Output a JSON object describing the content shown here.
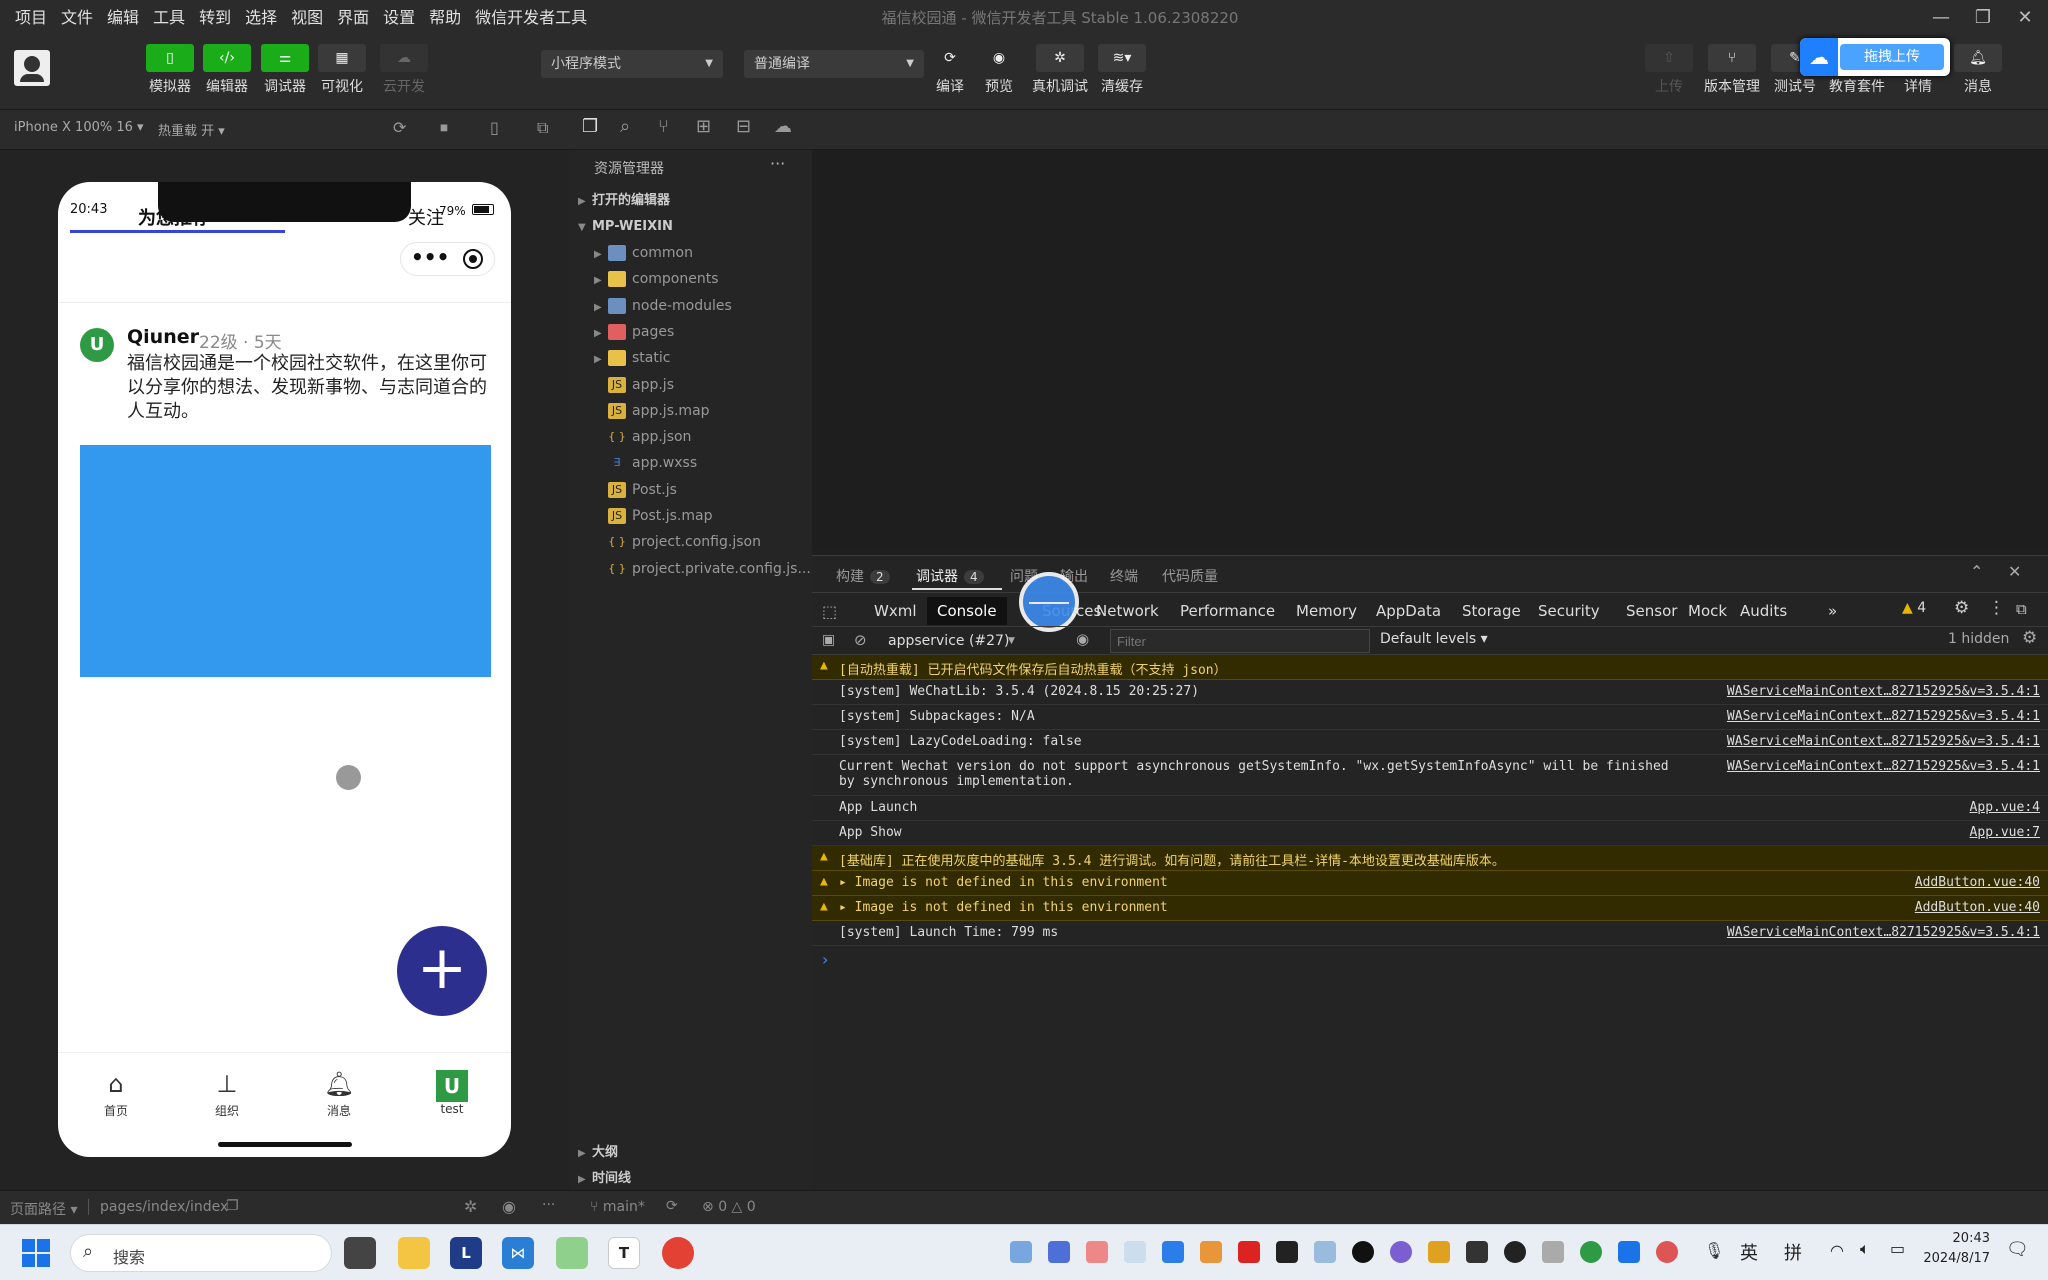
{
  "menubar": {
    "items": [
      "项目",
      "文件",
      "编辑",
      "工具",
      "转到",
      "选择",
      "视图",
      "界面",
      "设置",
      "帮助",
      "微信开发者工具"
    ],
    "title": "福信校园通 - 微信开发者工具 Stable 1.06.2308220"
  },
  "toolbar": {
    "simulator": "模拟器",
    "editor": "编辑器",
    "debugger": "调试器",
    "visual": "可视化",
    "cloud": "云开发",
    "mode": "小程序模式",
    "compile_mode": "普通编译",
    "compile": "编译",
    "preview": "预览",
    "real_debug": "真机调试",
    "clear_cache": "清缓存",
    "upload": "上传",
    "version": "版本管理",
    "test": "测试号",
    "edu": "教育套件",
    "details": "详情",
    "messages": "消息",
    "drag_upload": "拖拽上传"
  },
  "subbar": {
    "device": "iPhone X 100% 16",
    "hot_reload": "热重载 开"
  },
  "phone": {
    "time": "20:43",
    "tab_left": "为您推荐",
    "tab_right": "关注",
    "battery": "79%",
    "post": {
      "avatar": "U",
      "user": "Qiuner",
      "meta": "22级 · 5天",
      "text": "福信校园通是一个校园社交软件，在这里你可以分享你的想法、发现新事物、与志同道合的人互动。"
    },
    "image_color": "#3399ee",
    "fab": "+",
    "nav": [
      {
        "label": "首页",
        "icon": "home-icon"
      },
      {
        "label": "组织",
        "icon": "org-icon"
      },
      {
        "label": "消息",
        "icon": "bell-icon"
      },
      {
        "label": "test",
        "icon": "u-avatar-icon"
      }
    ]
  },
  "explorer": {
    "title": "资源管理器",
    "open_editors": "打开的编辑器",
    "root": "MP-WEIXIN",
    "items": [
      {
        "name": "common",
        "type": "folder",
        "color": "#6b8fbf"
      },
      {
        "name": "components",
        "type": "folder",
        "color": "#e8c14a"
      },
      {
        "name": "node-modules",
        "type": "folder",
        "color": "#6b8fbf"
      },
      {
        "name": "pages",
        "type": "folder",
        "color": "#e06060"
      },
      {
        "name": "static",
        "type": "folder",
        "color": "#e8c14a"
      },
      {
        "name": "app.js",
        "type": "js",
        "color": "#d9b23b"
      },
      {
        "name": "app.js.map",
        "type": "map",
        "color": "#d9b23b"
      },
      {
        "name": "app.json",
        "type": "json",
        "color": "#d9b23b"
      },
      {
        "name": "app.wxss",
        "type": "wxss",
        "color": "#4a7fd9"
      },
      {
        "name": "Post.js",
        "type": "js",
        "color": "#d9b23b"
      },
      {
        "name": "Post.js.map",
        "type": "map",
        "color": "#d9b23b"
      },
      {
        "name": "project.config.json",
        "type": "json",
        "color": "#d9b23b"
      },
      {
        "name": "project.private.config.js...",
        "type": "json",
        "color": "#d9b23b"
      }
    ],
    "outline": "大纲",
    "timeline": "时间线"
  },
  "devtools": {
    "tabs": [
      {
        "label": "构建",
        "badge": "2"
      },
      {
        "label": "调试器",
        "badge": "4"
      },
      {
        "label": "问题",
        "badge": ""
      },
      {
        "label": "输出",
        "badge": ""
      },
      {
        "label": "终端",
        "badge": ""
      },
      {
        "label": "代码质量",
        "badge": ""
      }
    ],
    "panel_tabs": [
      "Wxml",
      "Console",
      "Sources",
      "Network",
      "Performance",
      "Memory",
      "AppData",
      "Storage",
      "Security",
      "Sensor",
      "Mock",
      "Audits"
    ],
    "more": "»",
    "warn_count": "4",
    "context": "appservice (#27)",
    "filter_placeholder": "Filter",
    "levels": "Default levels",
    "hidden": "1 hidden",
    "prompt": "›",
    "logs": [
      {
        "level": "warn",
        "msg": "[自动热重载] 已开启代码文件保存后自动热重载（不支持 json）",
        "src": ""
      },
      {
        "level": "info",
        "msg": "[system] WeChatLib: 3.5.4 (2024.8.15 20:25:27)",
        "src": "WAServiceMainContext…827152925&v=3.5.4:1"
      },
      {
        "level": "info",
        "msg": "[system] Subpackages: N/A",
        "src": "WAServiceMainContext…827152925&v=3.5.4:1"
      },
      {
        "level": "info",
        "msg": "[system] LazyCodeLoading: false",
        "src": "WAServiceMainContext…827152925&v=3.5.4:1"
      },
      {
        "level": "info",
        "msg": "Current Wechat version do not support asynchronous getSystemInfo. \"wx.getSystemInfoAsync\" will be finished\nby synchronous implementation.",
        "src": "WAServiceMainContext…827152925&v=3.5.4:1"
      },
      {
        "level": "info",
        "msg": "App Launch",
        "src": "App.vue:4"
      },
      {
        "level": "info",
        "msg": "App Show",
        "src": "App.vue:7"
      },
      {
        "level": "warn",
        "msg": "[基础库] 正在使用灰度中的基础库 3.5.4 进行调试。如有问题，请前往工具栏-详情-本地设置更改基础库版本。",
        "src": ""
      },
      {
        "level": "warn",
        "msg": "▸ Image is not defined in this environment",
        "src": "AddButton.vue:40"
      },
      {
        "level": "warn",
        "msg": "▸ Image is not defined in this environment",
        "src": "AddButton.vue:40"
      },
      {
        "level": "info",
        "msg": "[system] Launch Time: 799 ms",
        "src": "WAServiceMainContext…827152925&v=3.5.4:1"
      }
    ]
  },
  "statusbar": {
    "path_label": "页面路径",
    "path": "pages/index/index",
    "branch": "main*",
    "errors": "0",
    "warnings": "0"
  },
  "taskbar": {
    "search": "搜索",
    "ime1": "英",
    "ime2": "拼",
    "time": "20:43",
    "date": "2024/8/17"
  }
}
